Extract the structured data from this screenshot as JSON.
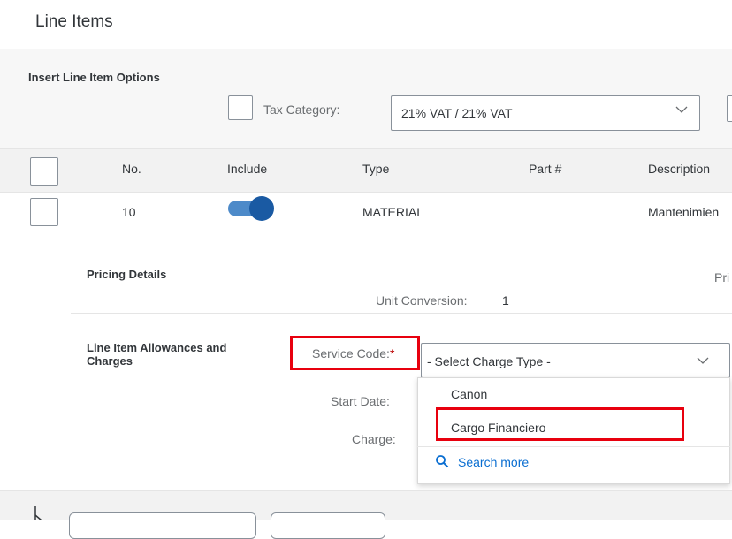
{
  "page": {
    "title": "Line Items"
  },
  "insert_options": {
    "title": "Insert Line Item Options",
    "tax_category_label": "Tax Category:",
    "tax_category_value": "21% VAT / 21% VAT"
  },
  "table": {
    "columns": [
      "No.",
      "Include",
      "Type",
      "Part #",
      "Description"
    ],
    "rows": [
      {
        "no": "10",
        "include": true,
        "type": "MATERIAL",
        "part": "",
        "description": "Mantenimien"
      }
    ]
  },
  "pricing": {
    "title": "Pricing Details",
    "cut_label": "Pri",
    "unit_conversion_label": "Unit Conversion:",
    "unit_conversion_value": "1"
  },
  "allowances": {
    "title": "Line Item Allowances and Charges",
    "service_code_label": "Service Code:",
    "required_marker": "*",
    "charge_type_placeholder": "- Select Charge Type -",
    "start_date_label": "Start Date:",
    "charge_label": "Charge:",
    "dropdown_options": [
      "Canon",
      "Cargo Financiero"
    ],
    "search_more": "Search more"
  },
  "colors": {
    "accent": "#0a6ed1",
    "toggle_on": "#1a5aa3",
    "highlight": "#e8000e",
    "required": "#bb0000"
  }
}
